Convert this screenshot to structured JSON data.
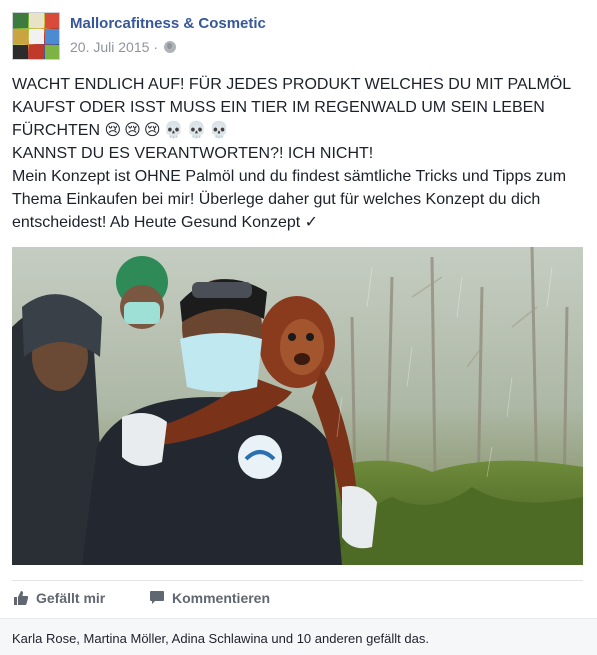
{
  "post": {
    "page_name": "Mallorcafitness & Cosmetic",
    "date": "20. Juli 2015",
    "separator": "·",
    "privacy_icon": "globe-icon",
    "text_lines": [
      "WACHT ENDLICH AUF! FÜR JEDES PRODUKT WELCHES DU MIT PALMÖL",
      "KAUFST ODER ISST MUSS EIN TIER IM REGENWALD UM SEIN LEBEN",
      "FÜRCHTEN",
      "KANNST DU ES VERANTWORTEN?! ICH NICHT!",
      "Mein Konzept ist OHNE Palmöl und du findest sämtliche Tricks und Tipps zum",
      "Thema Einkaufen bei mir! Überlege daher gut für welches Konzept du dich",
      "entscheidest! Ab Heute Gesund Konzept"
    ],
    "emojis": [
      "😢",
      "😢",
      "😢",
      "💀",
      "💀",
      "💀"
    ],
    "checkmark": "✓",
    "photo_alt": "Rescue worker in face mask carrying an orangutan on his back through a rainy forest clearing"
  },
  "actions": {
    "like_label": "Gefällt mir",
    "like_icon": "thumbs-up-icon",
    "comment_label": "Kommentieren",
    "comment_icon": "comment-icon"
  },
  "likes": {
    "summary": "Karla Rose, Martina Möller, Adina Schlawina und 10 anderen gefällt das."
  },
  "colors": {
    "link": "#365899",
    "meta": "#90949c",
    "action": "#606770",
    "likes_bg": "#f6f7f9"
  }
}
